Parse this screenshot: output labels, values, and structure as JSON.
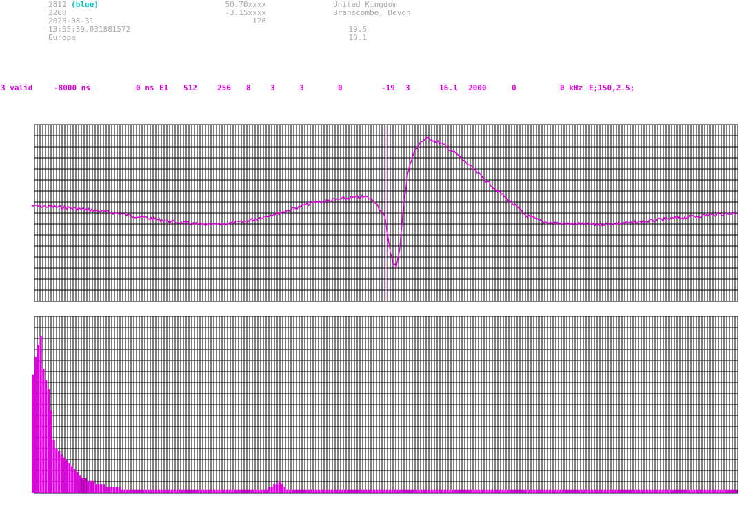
{
  "header": {
    "station_id": "2812",
    "station_color_label": "(blue)",
    "number": "2208",
    "date": "2025-08-31",
    "time": "13:55:39.031881572",
    "region": "Europe",
    "latitude": "50.70xxxx",
    "longitude": "-3.15xxxx",
    "elevation": "126",
    "country": "United Kingdom",
    "location": "Branscombe, Devon",
    "value_a": "19.5",
    "value_b": "10.1"
  },
  "params": [
    {
      "text": "3 valid"
    },
    {
      "text": "-8000 ns"
    },
    {
      "text": "0 ns"
    },
    {
      "text": "E1"
    },
    {
      "text": "512"
    },
    {
      "text": "256"
    },
    {
      "text": "8"
    },
    {
      "text": "3"
    },
    {
      "text": "3"
    },
    {
      "text": "0"
    },
    {
      "text": "-19"
    },
    {
      "text": "3"
    },
    {
      "text": "16.1"
    },
    {
      "text": "2000"
    },
    {
      "text": "0"
    },
    {
      "text": "0 kHz"
    },
    {
      "text": "E;150,2.5;"
    }
  ],
  "colors": {
    "trace": "#e000e0",
    "grid": "#000000",
    "header_text": "#a8a8a8",
    "station_color": "#00c8c8"
  },
  "chart_data": [
    {
      "type": "line",
      "name": "waveform",
      "x_range": [
        -8000,
        8000
      ],
      "y_range": [
        -1,
        1
      ],
      "trigger_marker": "vertical line near center",
      "points": [
        [
          -8000,
          0.08
        ],
        [
          -7200,
          0.06
        ],
        [
          -6400,
          0.02
        ],
        [
          -5600,
          -0.04
        ],
        [
          -4800,
          -0.1
        ],
        [
          -4000,
          -0.14
        ],
        [
          -3200,
          -0.1
        ],
        [
          -2400,
          0.0
        ],
        [
          -1600,
          0.12
        ],
        [
          -800,
          0.17
        ],
        [
          -400,
          0.18
        ],
        [
          -200,
          0.12
        ],
        [
          0,
          -0.05
        ],
        [
          100,
          -0.35
        ],
        [
          180,
          -0.58
        ],
        [
          260,
          -0.6
        ],
        [
          340,
          -0.4
        ],
        [
          420,
          0.05
        ],
        [
          520,
          0.45
        ],
        [
          650,
          0.67
        ],
        [
          800,
          0.8
        ],
        [
          1000,
          0.85
        ],
        [
          1300,
          0.78
        ],
        [
          1600,
          0.68
        ],
        [
          2000,
          0.5
        ],
        [
          2400,
          0.32
        ],
        [
          2800,
          0.15
        ],
        [
          3200,
          -0.03
        ],
        [
          3600,
          -0.1
        ],
        [
          4000,
          -0.12
        ],
        [
          4800,
          -0.13
        ],
        [
          5600,
          -0.11
        ],
        [
          6400,
          -0.07
        ],
        [
          7200,
          -0.03
        ],
        [
          8000,
          0.0
        ]
      ]
    },
    {
      "type": "bar",
      "name": "histogram",
      "values": [
        40,
        46,
        50,
        53,
        42,
        38,
        35,
        28,
        18,
        15,
        14,
        13,
        12,
        11,
        10,
        9,
        8,
        7,
        6,
        5,
        5,
        4,
        4,
        4,
        3,
        3,
        3,
        3,
        2,
        2,
        2,
        2,
        2,
        2,
        1,
        1,
        1,
        1,
        1,
        1,
        1,
        1,
        1,
        1,
        1,
        1,
        1,
        1,
        1,
        1,
        1,
        1,
        1,
        1,
        1,
        1,
        1,
        1,
        1,
        1,
        1,
        1,
        1,
        1,
        1,
        1,
        1,
        1,
        1,
        1,
        1,
        1,
        1,
        1,
        1,
        1,
        1,
        1,
        1,
        1,
        1,
        1,
        1,
        1,
        1,
        1,
        1,
        1,
        1,
        1,
        2,
        2,
        3,
        3,
        4,
        3,
        2,
        1,
        1,
        1,
        1,
        1,
        1,
        1,
        1,
        1,
        1,
        1,
        1,
        1,
        1,
        1,
        1,
        1,
        1,
        1,
        1,
        1,
        1,
        1,
        1,
        1,
        1,
        1,
        1,
        1,
        1,
        1,
        1,
        1,
        1,
        1,
        1,
        1,
        1,
        1,
        1,
        1,
        1,
        1,
        1,
        1,
        1,
        1,
        1,
        1,
        1,
        1,
        1,
        1,
        1,
        1,
        1,
        1,
        1,
        1,
        1,
        1,
        1,
        1,
        1,
        1,
        1,
        1,
        1,
        1,
        1,
        1,
        1,
        1,
        1,
        1,
        1,
        1,
        1,
        1,
        1,
        1,
        1,
        1,
        1,
        1,
        1,
        1,
        1,
        1,
        1,
        1,
        1,
        1,
        1,
        1,
        1,
        1,
        1,
        1,
        1,
        1,
        1,
        1,
        1,
        1,
        1,
        1,
        1,
        1,
        1,
        1,
        1,
        1,
        1,
        1,
        1,
        1,
        1,
        1,
        1,
        1,
        1,
        1,
        1,
        1,
        1,
        1,
        1,
        1,
        1,
        1,
        1,
        1,
        1,
        1,
        1,
        1,
        1,
        1,
        1,
        1,
        1,
        1,
        1,
        1,
        1,
        1,
        1,
        1,
        1,
        1,
        1,
        1,
        1,
        1,
        1,
        1,
        1,
        1,
        1,
        1,
        1,
        1,
        1,
        1,
        1,
        1,
        1,
        1,
        1,
        1,
        1
      ],
      "y_range": [
        0,
        56
      ]
    }
  ]
}
